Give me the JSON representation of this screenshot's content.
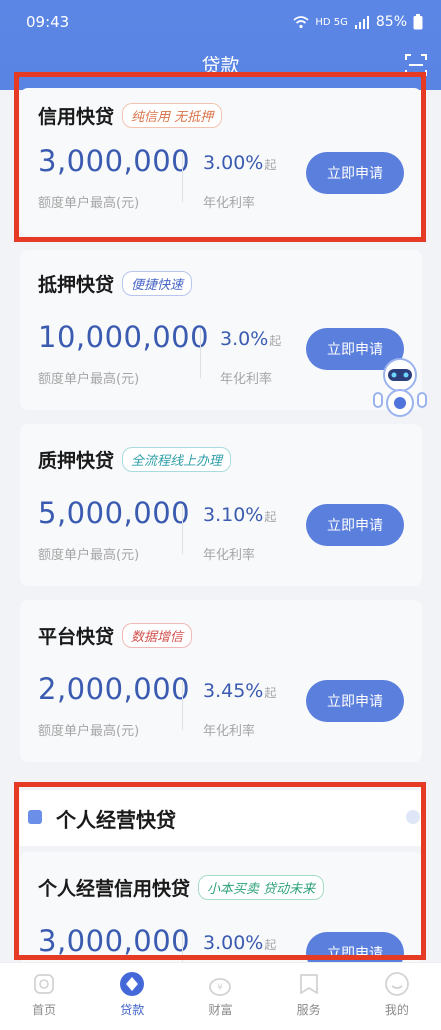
{
  "status": {
    "time": "09:43",
    "indicators": "HD 5G",
    "battery": "85%"
  },
  "header": {
    "title": "贷款"
  },
  "loans": [
    {
      "title": "信用快贷",
      "tag": "纯信用 无抵押",
      "amount": "3,000,000",
      "amount_label": "额度单户最高(元)",
      "rate": "3.00%",
      "rate_suffix": "起",
      "rate_label": "年化利率",
      "button": "立即申请"
    },
    {
      "title": "抵押快贷",
      "tag": "便捷快速",
      "amount": "10,000,000",
      "amount_label": "额度单户最高(元)",
      "rate": "3.0%",
      "rate_suffix": "起",
      "rate_label": "年化利率",
      "button": "立即申请"
    },
    {
      "title": "质押快贷",
      "tag": "全流程线上办理",
      "amount": "5,000,000",
      "amount_label": "额度单户最高(元)",
      "rate": "3.10%",
      "rate_suffix": "起",
      "rate_label": "年化利率",
      "button": "立即申请"
    },
    {
      "title": "平台快贷",
      "tag": "数据增信",
      "amount": "2,000,000",
      "amount_label": "额度单户最高(元)",
      "rate": "3.45%",
      "rate_suffix": "起",
      "rate_label": "年化利率",
      "button": "立即申请"
    }
  ],
  "section": {
    "title": "个人经营快贷",
    "loan": {
      "title": "个人经营信用快贷",
      "tag": "小本买卖 贷动未来",
      "amount": "3,000,000",
      "rate": "3.00%",
      "rate_suffix": "起",
      "button": "立即申请"
    }
  },
  "tabs": [
    {
      "label": "首页",
      "icon": "home-icon"
    },
    {
      "label": "贷款",
      "icon": "loan-icon",
      "active": true
    },
    {
      "label": "财富",
      "icon": "wealth-icon"
    },
    {
      "label": "服务",
      "icon": "service-icon"
    },
    {
      "label": "我的",
      "icon": "profile-icon"
    }
  ],
  "colors": {
    "primary": "#5b7fdc",
    "header": "#5b86e5",
    "highlight": "#e53a24",
    "amount": "#3a5bb0"
  }
}
